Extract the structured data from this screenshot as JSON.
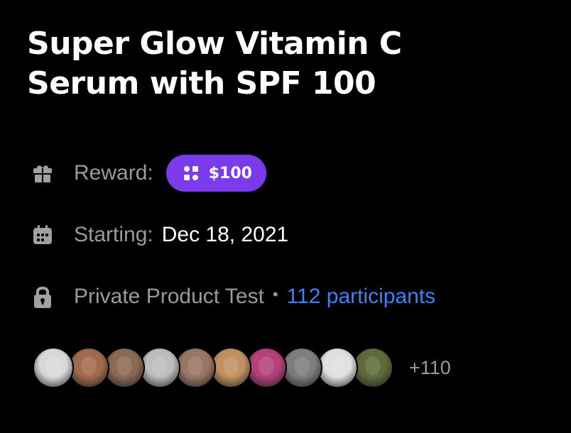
{
  "title": {
    "line1": "Super Glow Vitamin C",
    "line2": "Serum with SPF 100"
  },
  "reward": {
    "label": "Reward:",
    "amount": "$100",
    "icon": "gift-icon",
    "badge_icon": "grid-cross-icon",
    "badge_color": "#7c3aed"
  },
  "starting": {
    "label": "Starting:",
    "date": "Dec 18, 2021",
    "icon": "calendar-icon"
  },
  "access": {
    "label": "Private Product Test",
    "separator": "•",
    "participants": "112 participants",
    "icon": "lock-icon",
    "link_color": "#3b82f6"
  },
  "avatars": {
    "colors": [
      "#d9d9d9",
      "#a06a4e",
      "#8a6a55",
      "#bdbdbd",
      "#9a7565",
      "#c09060",
      "#b5407a",
      "#7d7d7d",
      "#e0e0e0",
      "#5e6a3a"
    ],
    "more_label": "+110"
  }
}
